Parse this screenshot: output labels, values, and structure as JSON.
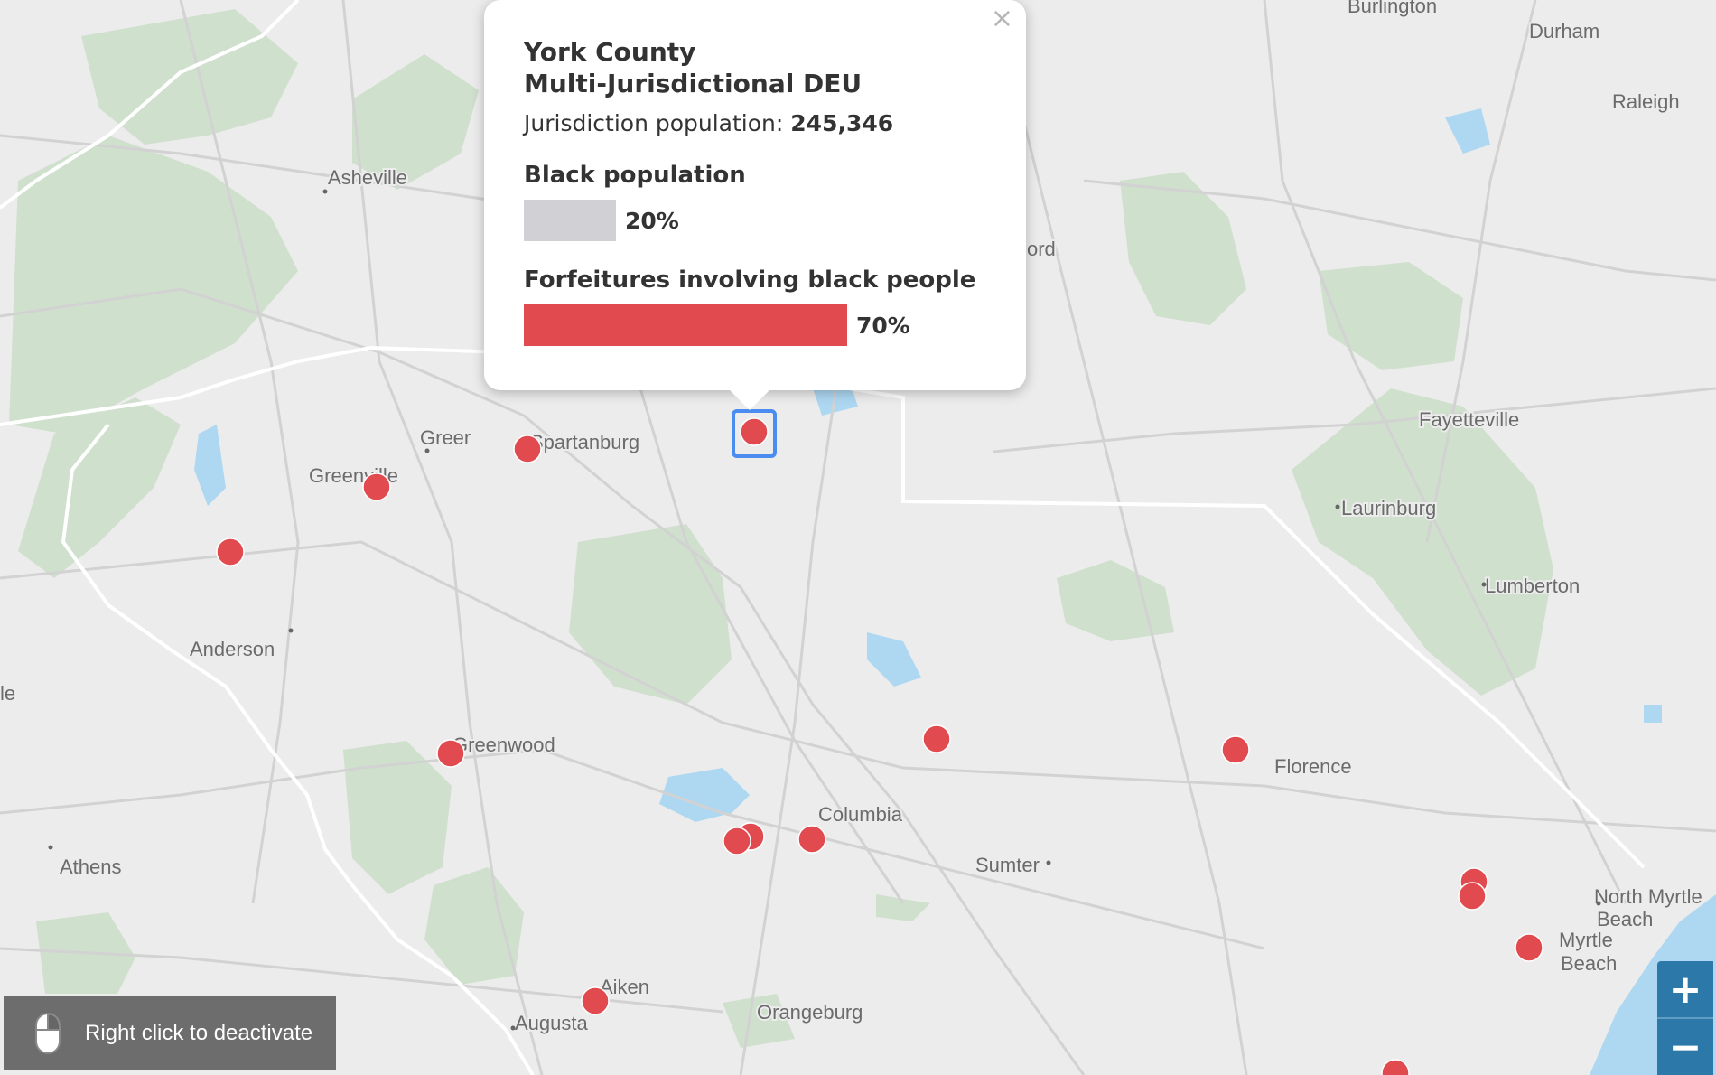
{
  "places": [
    {
      "name": "Burlington"
    },
    {
      "name": "Durham"
    },
    {
      "name": "Raleigh"
    },
    {
      "name": "Asheville"
    },
    {
      "name": "ord"
    },
    {
      "name": "Fayetteville"
    },
    {
      "name": "Laurinburg"
    },
    {
      "name": "Lumberton"
    },
    {
      "name": "Greer"
    },
    {
      "name": "Spartanburg"
    },
    {
      "name": "Greenville"
    },
    {
      "name": "Anderson"
    },
    {
      "name": "Greenwood"
    },
    {
      "name": "Florence"
    },
    {
      "name": "Columbia"
    },
    {
      "name": "Sumter"
    },
    {
      "name": "Athens"
    },
    {
      "name": "North Myrtle"
    },
    {
      "name": "Beach"
    },
    {
      "name": "Myrtle"
    },
    {
      "name": "Beach"
    },
    {
      "name": "Aiken"
    },
    {
      "name": "Augusta"
    },
    {
      "name": "Orangeburg"
    },
    {
      "name": "le"
    }
  ],
  "popup": {
    "title_line1": "York County",
    "title_line2": "Multi-Jurisdictional DEU",
    "population_label": "Jurisdiction population:",
    "population_value": "245,346",
    "black_population_label": "Black population",
    "black_population_value": "20%",
    "black_population_fraction": 0.2,
    "forfeitures_label": "Forfeitures involving black people",
    "forfeitures_value": "70%",
    "forfeitures_fraction": 0.7,
    "close_symbol": "×"
  },
  "controls": {
    "deactivate_text": "Right click to deactivate",
    "zoom_in": "+",
    "zoom_out": "−"
  },
  "colors": {
    "marker": "#e14a4f",
    "black_population_bar": "#d0d0d5",
    "forfeitures_bar": "#e14a4f",
    "forest": "#cfe0cd",
    "water": "#aed8f2",
    "zoom": "#2c78a8"
  }
}
